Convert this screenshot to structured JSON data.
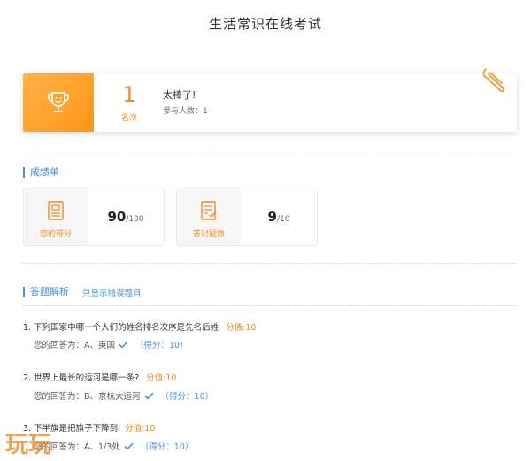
{
  "page": {
    "title": "生活常识在线考试"
  },
  "rank": {
    "number": "1",
    "unit": "名次",
    "praise": "太棒了!",
    "participants": "参与人数：1"
  },
  "report": {
    "section_title": "成绩单",
    "score_label": "您的得分",
    "score_value": "90",
    "score_total": "/100",
    "correct_label": "答对题数",
    "correct_value": "9",
    "correct_total": "/10"
  },
  "analysis": {
    "section_title": "答题解析",
    "wrong_only_link": "只显示错误题目"
  },
  "questions": [
    {
      "text": "1. 下列国家中哪一个人们的姓名排名次序是先名后姓",
      "points": "分值:10",
      "answer": "您的回答为：A、英国",
      "score": "（得分：10）"
    },
    {
      "text": "2. 世界上最长的运河是哪一条?",
      "points": "分值:10",
      "answer": "您的回答为：B、京杭大运河",
      "score": "（得分：10）"
    },
    {
      "text": "3. 下半旗是把旗子下降到",
      "points": "分值:10",
      "answer": "您的回答为：A、1/3处",
      "score": "（得分：10）"
    }
  ],
  "watermark": {
    "logo_text": "玩玩"
  },
  "colors": {
    "accent": "#4a90d9",
    "orange": "#f08a24",
    "check": "#4a90d9"
  }
}
